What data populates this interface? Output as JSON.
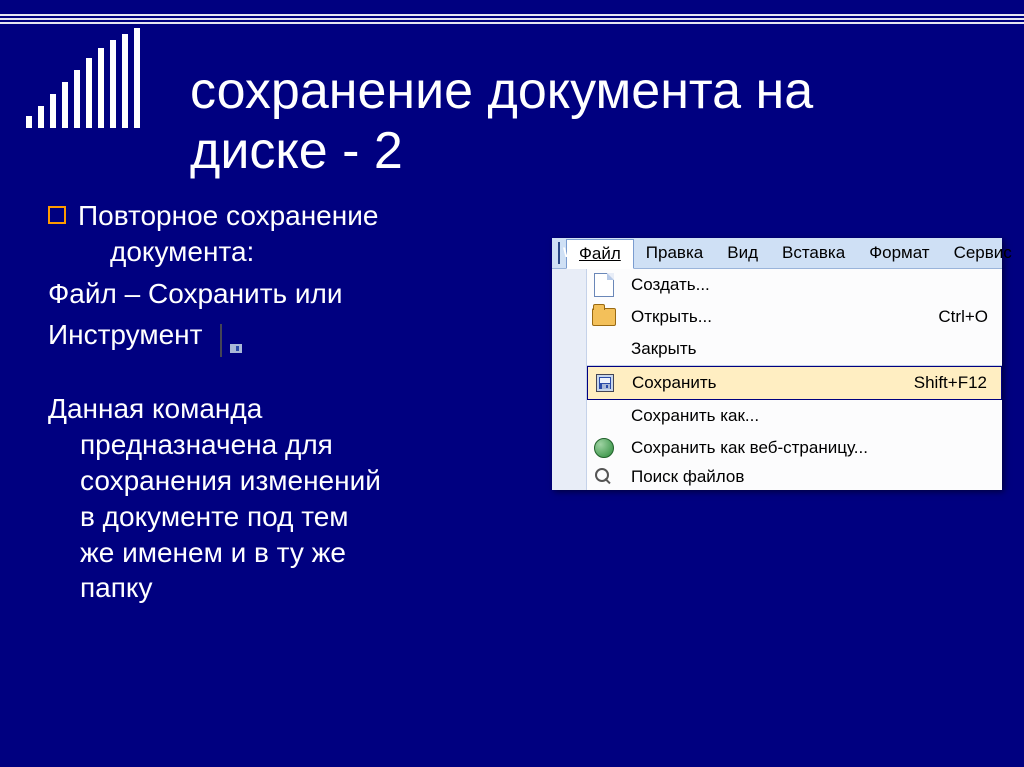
{
  "title_line1": "сохранение документа на",
  "title_line2": "диске - 2",
  "bullet1_line1": "Повторное сохранение",
  "bullet1_line2": "документа:",
  "line_file_save": "Файл – Сохранить или",
  "line_instrument": "Инструмент",
  "para2_l1": "Данная команда",
  "para2_l2": "предназначена для",
  "para2_l3": "сохранения изменений",
  "para2_l4": "в документе под тем",
  "para2_l5": "же именем и в ту же",
  "para2_l6": "папку",
  "menubar": {
    "file": "Файл",
    "edit": "Правка",
    "view": "Вид",
    "insert": "Вставка",
    "format": "Формат",
    "service": "Сервис"
  },
  "menu": {
    "create": "Создать...",
    "open": "Открыть...",
    "open_shortcut": "Ctrl+O",
    "close": "Закрыть",
    "save": "Сохранить",
    "save_shortcut": "Shift+F12",
    "save_as": "Сохранить как...",
    "save_as_web": "Сохранить как веб-страницу...",
    "search_files": "Поиск файлов"
  }
}
